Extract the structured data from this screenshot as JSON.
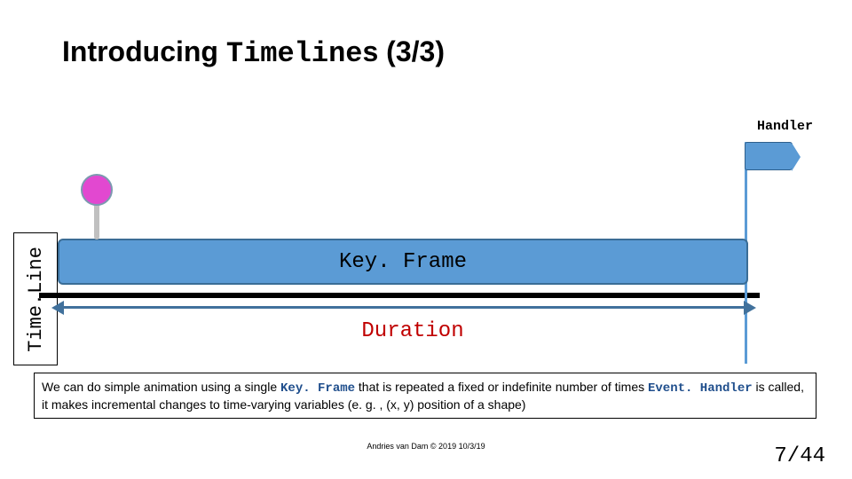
{
  "title": {
    "pre": "Introducing ",
    "code": "Timeline",
    "post": "s (3/3)"
  },
  "handler_label": "Handler",
  "timeline_axis_label": "Time.Line",
  "keyframe_label": "Key. Frame",
  "duration_label": "Duration",
  "explain": {
    "t1": "We can do simple animation using a single ",
    "keyframe": "Key. Frame",
    "t2": " that is repeated a fixed or indefinite number of times ",
    "eventhandler": "Event. Handler",
    "t3": " is called, it makes incremental changes to time-varying variables (e. g. , (x, y) position of a shape)"
  },
  "footer_center": "Andries van Dam © 2019 10/3/19",
  "footer_right": "7/44"
}
